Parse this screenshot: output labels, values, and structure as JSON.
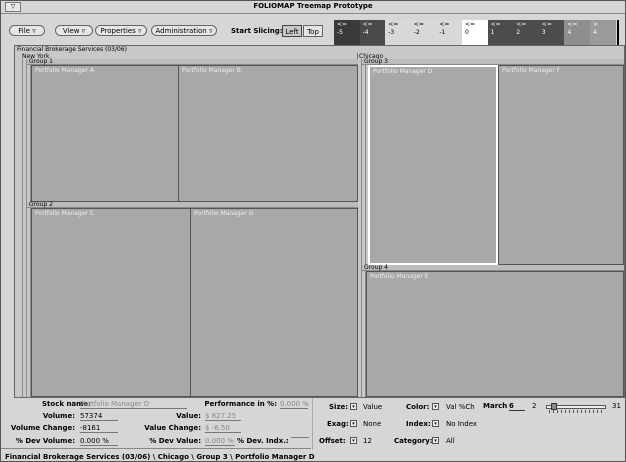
{
  "window": {
    "title": "FOLIOMAP Treemap Prototype",
    "menu_glyph": "▽"
  },
  "toolbar": {
    "menus": [
      {
        "label": "File ▿"
      },
      {
        "label": "View ▿"
      },
      {
        "label": "Properties ▿"
      },
      {
        "label": "Administration ▿"
      }
    ],
    "slicing_label": "Start Slicing:",
    "slice_left": "Left",
    "slice_top": "Top"
  },
  "legend": [
    {
      "op": "<=",
      "value": "-5",
      "color": "#3a3a3a"
    },
    {
      "op": "<=",
      "value": "-4",
      "color": "#4a4a4a"
    },
    {
      "op": "<=",
      "value": "-3",
      "color": "#d8d8d8"
    },
    {
      "op": "<=",
      "value": "-2",
      "color": "#d8d8d8"
    },
    {
      "op": "<=",
      "value": "-1",
      "color": "#d8d8d8"
    },
    {
      "op": "<=",
      "value": "0",
      "color": "#ffffff"
    },
    {
      "op": "<=",
      "value": "1",
      "color": "#4c4c4c"
    },
    {
      "op": "<=",
      "value": "2",
      "color": "#4c4c4c"
    },
    {
      "op": "<=",
      "value": "3",
      "color": "#4c4c4c"
    },
    {
      "op": "<=",
      "value": "4",
      "color": "#8e8e8e"
    },
    {
      "op": ">",
      "value": "4",
      "color": "#9a9a9a"
    }
  ],
  "treemap": {
    "root": "Financial Brokerage Services (03/06)",
    "regions": [
      {
        "name": "New York",
        "groups": [
          {
            "name": "Group 1",
            "managers": [
              "Portfolio Manager A",
              "Portfolio Manager B"
            ]
          },
          {
            "name": "Group 2",
            "managers": [
              "Portfolio Manager C",
              "Portfolio Manager G"
            ]
          }
        ]
      },
      {
        "name": "Chicago",
        "groups": [
          {
            "name": "Group 3",
            "managers": [
              "Portfolio Manager D",
              "Portfolio Manager F"
            ]
          },
          {
            "name": "Group 4",
            "managers": [
              "Portfolio Manager E"
            ]
          }
        ]
      }
    ]
  },
  "details": {
    "stock_name_label": "Stock name:",
    "stock_name": "Portfolio Manager D",
    "performance_label": "Performance in %:",
    "performance": "0.000 %",
    "volume_label": "Volume:",
    "volume": "57374",
    "value_label": "Value:",
    "value": "$ 827.25",
    "volume_change_label": "Volume Change:",
    "volume_change": "-8161",
    "value_change_label": "Value Change:",
    "value_change": "$ -6.50",
    "pct_dev_volume_label": "% Dev Volume:",
    "pct_dev_volume": "0.000 %",
    "pct_dev_value_label": "% Dev Value:",
    "pct_dev_value": "0.000 %",
    "pct_dev_index_label": "% Dev. Indx.:",
    "pct_dev_index": ""
  },
  "settings": {
    "size_label": "Size:",
    "size": "Value",
    "color_label": "Color:",
    "color": "Val %Ch",
    "exag_label": "Exag:",
    "exag": "None",
    "index_label": "Index:",
    "index": "No Index",
    "offset_label": "Offset:",
    "offset": "12",
    "category_label": "Category:",
    "category": "All",
    "date_month": "March",
    "date_day": "6",
    "slider_min": "2",
    "slider_max": "31"
  },
  "breadcrumb": "Financial Brokerage Services (03/06) \\ Chicago \\ Group 3 \\ Portfolio Manager D"
}
